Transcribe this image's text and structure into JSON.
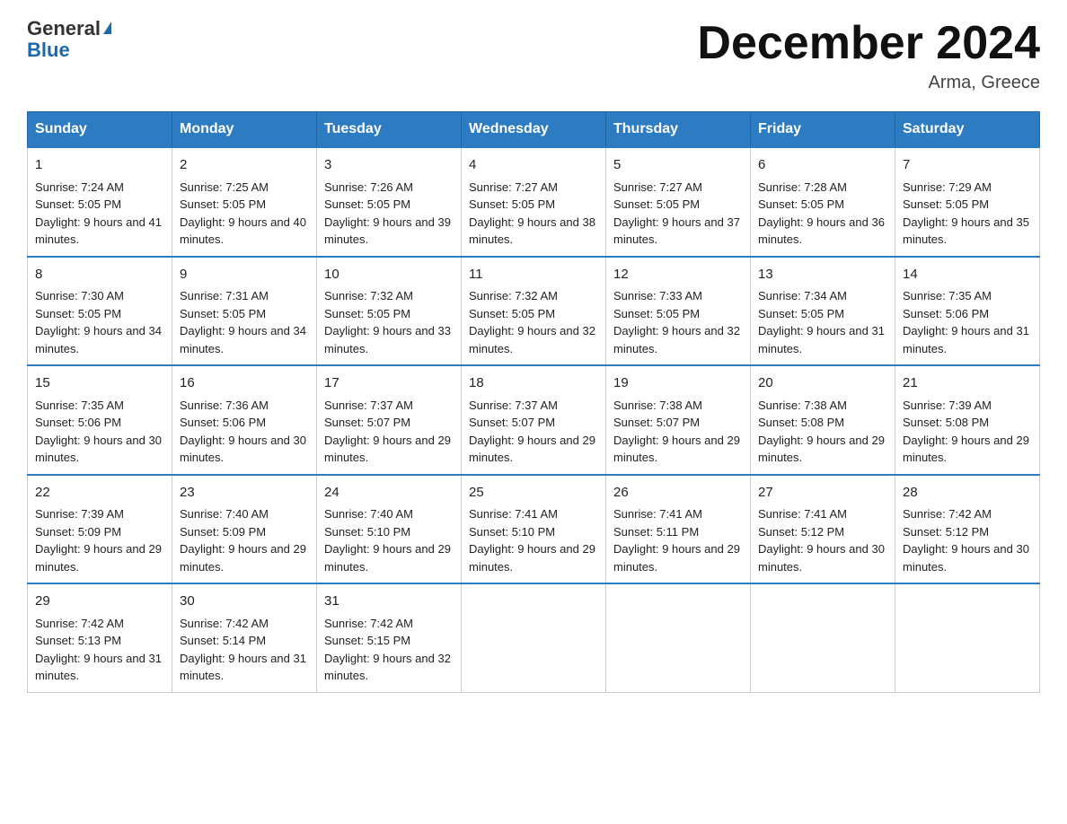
{
  "logo": {
    "line1": "General",
    "line2": "Blue"
  },
  "title": "December 2024",
  "subtitle": "Arma, Greece",
  "weekdays": [
    "Sunday",
    "Monday",
    "Tuesday",
    "Wednesday",
    "Thursday",
    "Friday",
    "Saturday"
  ],
  "weeks": [
    [
      {
        "day": "1",
        "sunrise": "7:24 AM",
        "sunset": "5:05 PM",
        "daylight": "9 hours and 41 minutes."
      },
      {
        "day": "2",
        "sunrise": "7:25 AM",
        "sunset": "5:05 PM",
        "daylight": "9 hours and 40 minutes."
      },
      {
        "day": "3",
        "sunrise": "7:26 AM",
        "sunset": "5:05 PM",
        "daylight": "9 hours and 39 minutes."
      },
      {
        "day": "4",
        "sunrise": "7:27 AM",
        "sunset": "5:05 PM",
        "daylight": "9 hours and 38 minutes."
      },
      {
        "day": "5",
        "sunrise": "7:27 AM",
        "sunset": "5:05 PM",
        "daylight": "9 hours and 37 minutes."
      },
      {
        "day": "6",
        "sunrise": "7:28 AM",
        "sunset": "5:05 PM",
        "daylight": "9 hours and 36 minutes."
      },
      {
        "day": "7",
        "sunrise": "7:29 AM",
        "sunset": "5:05 PM",
        "daylight": "9 hours and 35 minutes."
      }
    ],
    [
      {
        "day": "8",
        "sunrise": "7:30 AM",
        "sunset": "5:05 PM",
        "daylight": "9 hours and 34 minutes."
      },
      {
        "day": "9",
        "sunrise": "7:31 AM",
        "sunset": "5:05 PM",
        "daylight": "9 hours and 34 minutes."
      },
      {
        "day": "10",
        "sunrise": "7:32 AM",
        "sunset": "5:05 PM",
        "daylight": "9 hours and 33 minutes."
      },
      {
        "day": "11",
        "sunrise": "7:32 AM",
        "sunset": "5:05 PM",
        "daylight": "9 hours and 32 minutes."
      },
      {
        "day": "12",
        "sunrise": "7:33 AM",
        "sunset": "5:05 PM",
        "daylight": "9 hours and 32 minutes."
      },
      {
        "day": "13",
        "sunrise": "7:34 AM",
        "sunset": "5:05 PM",
        "daylight": "9 hours and 31 minutes."
      },
      {
        "day": "14",
        "sunrise": "7:35 AM",
        "sunset": "5:06 PM",
        "daylight": "9 hours and 31 minutes."
      }
    ],
    [
      {
        "day": "15",
        "sunrise": "7:35 AM",
        "sunset": "5:06 PM",
        "daylight": "9 hours and 30 minutes."
      },
      {
        "day": "16",
        "sunrise": "7:36 AM",
        "sunset": "5:06 PM",
        "daylight": "9 hours and 30 minutes."
      },
      {
        "day": "17",
        "sunrise": "7:37 AM",
        "sunset": "5:07 PM",
        "daylight": "9 hours and 29 minutes."
      },
      {
        "day": "18",
        "sunrise": "7:37 AM",
        "sunset": "5:07 PM",
        "daylight": "9 hours and 29 minutes."
      },
      {
        "day": "19",
        "sunrise": "7:38 AM",
        "sunset": "5:07 PM",
        "daylight": "9 hours and 29 minutes."
      },
      {
        "day": "20",
        "sunrise": "7:38 AM",
        "sunset": "5:08 PM",
        "daylight": "9 hours and 29 minutes."
      },
      {
        "day": "21",
        "sunrise": "7:39 AM",
        "sunset": "5:08 PM",
        "daylight": "9 hours and 29 minutes."
      }
    ],
    [
      {
        "day": "22",
        "sunrise": "7:39 AM",
        "sunset": "5:09 PM",
        "daylight": "9 hours and 29 minutes."
      },
      {
        "day": "23",
        "sunrise": "7:40 AM",
        "sunset": "5:09 PM",
        "daylight": "9 hours and 29 minutes."
      },
      {
        "day": "24",
        "sunrise": "7:40 AM",
        "sunset": "5:10 PM",
        "daylight": "9 hours and 29 minutes."
      },
      {
        "day": "25",
        "sunrise": "7:41 AM",
        "sunset": "5:10 PM",
        "daylight": "9 hours and 29 minutes."
      },
      {
        "day": "26",
        "sunrise": "7:41 AM",
        "sunset": "5:11 PM",
        "daylight": "9 hours and 29 minutes."
      },
      {
        "day": "27",
        "sunrise": "7:41 AM",
        "sunset": "5:12 PM",
        "daylight": "9 hours and 30 minutes."
      },
      {
        "day": "28",
        "sunrise": "7:42 AM",
        "sunset": "5:12 PM",
        "daylight": "9 hours and 30 minutes."
      }
    ],
    [
      {
        "day": "29",
        "sunrise": "7:42 AM",
        "sunset": "5:13 PM",
        "daylight": "9 hours and 31 minutes."
      },
      {
        "day": "30",
        "sunrise": "7:42 AM",
        "sunset": "5:14 PM",
        "daylight": "9 hours and 31 minutes."
      },
      {
        "day": "31",
        "sunrise": "7:42 AM",
        "sunset": "5:15 PM",
        "daylight": "9 hours and 32 minutes."
      },
      null,
      null,
      null,
      null
    ]
  ]
}
